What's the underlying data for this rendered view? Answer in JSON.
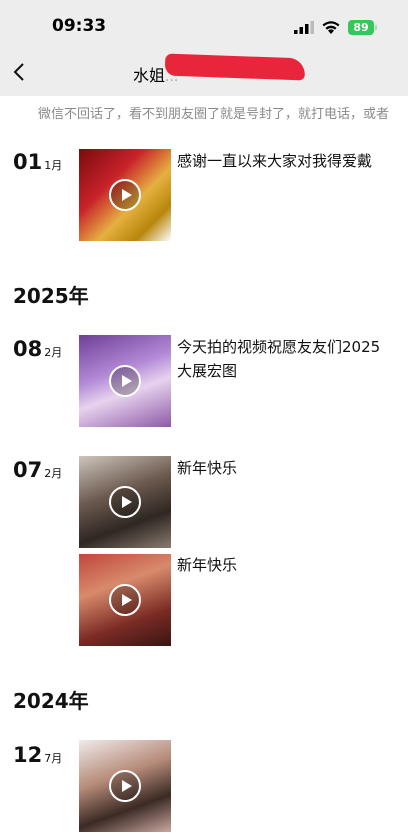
{
  "status_bar": {
    "time": "09:33",
    "battery": "89"
  },
  "nav": {
    "title_visible": "水姐",
    "title_obscured": "..."
  },
  "signature": "微信不回话了，看不到朋友圈了就是号封了，就打电话，或者",
  "timeline": {
    "p1": {
      "day": "01",
      "month": "1月",
      "caption": "感谢一直以来大家对我得爱戴"
    },
    "y2025": "2025年",
    "p2": {
      "day": "08",
      "month": "2月",
      "caption": "今天拍的视频祝愿友友们2025大展宏图"
    },
    "p3": {
      "day": "07",
      "month": "2月",
      "caption": "新年快乐"
    },
    "p4": {
      "caption": "新年快乐"
    },
    "y2024": "2024年",
    "p5": {
      "day": "12",
      "month": "7月"
    }
  },
  "icons": [
    "back-chevron-icon",
    "signal-icon",
    "wifi-icon",
    "battery-icon",
    "play-icon"
  ]
}
